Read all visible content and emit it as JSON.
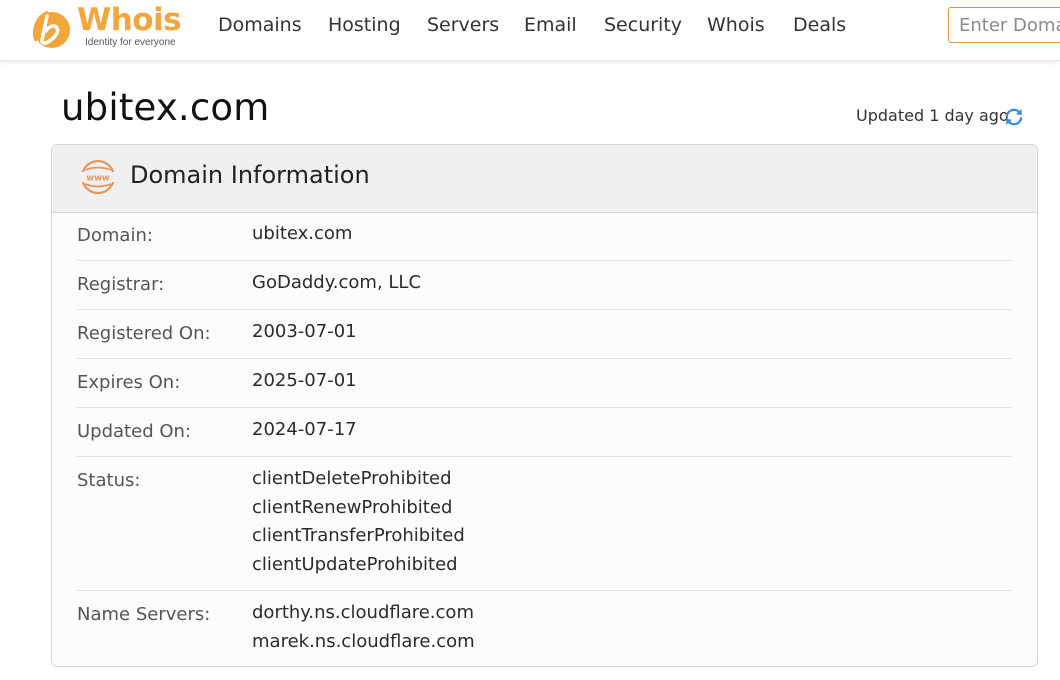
{
  "brand": {
    "name": "Whois",
    "tagline": "Identity for everyone",
    "accent_color": "#f2a63c"
  },
  "nav": {
    "items": [
      "Domains",
      "Hosting",
      "Servers",
      "Email",
      "Security",
      "Whois",
      "Deals"
    ]
  },
  "search": {
    "placeholder": "Enter Domain"
  },
  "page": {
    "title": "ubitex.com",
    "updated_text": "Updated 1 day ago",
    "refresh_icon": "refresh-icon"
  },
  "card": {
    "title": "Domain Information",
    "icon": "www-icon",
    "rows": [
      {
        "label": "Domain:",
        "values": [
          "ubitex.com"
        ]
      },
      {
        "label": "Registrar:",
        "values": [
          "GoDaddy.com, LLC"
        ]
      },
      {
        "label": "Registered On:",
        "values": [
          "2003-07-01"
        ]
      },
      {
        "label": "Expires On:",
        "values": [
          "2025-07-01"
        ]
      },
      {
        "label": "Updated On:",
        "values": [
          "2024-07-17"
        ]
      },
      {
        "label": "Status:",
        "values": [
          "clientDeleteProhibited",
          "clientRenewProhibited",
          "clientTransferProhibited",
          "clientUpdateProhibited"
        ]
      },
      {
        "label": "Name Servers:",
        "values": [
          "dorthy.ns.cloudflare.com",
          "marek.ns.cloudflare.com"
        ]
      }
    ]
  }
}
